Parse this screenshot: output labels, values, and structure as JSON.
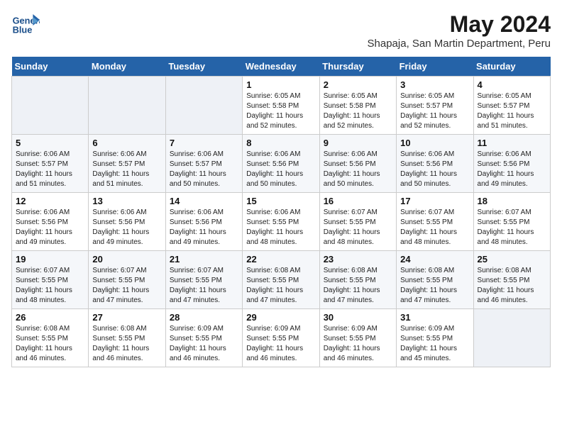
{
  "header": {
    "logo_line1": "General",
    "logo_line2": "Blue",
    "month_year": "May 2024",
    "location": "Shapaja, San Martin Department, Peru"
  },
  "days_of_week": [
    "Sunday",
    "Monday",
    "Tuesday",
    "Wednesday",
    "Thursday",
    "Friday",
    "Saturday"
  ],
  "weeks": [
    [
      {
        "day": "",
        "info": ""
      },
      {
        "day": "",
        "info": ""
      },
      {
        "day": "",
        "info": ""
      },
      {
        "day": "1",
        "info": "Sunrise: 6:05 AM\nSunset: 5:58 PM\nDaylight: 11 hours and 52 minutes."
      },
      {
        "day": "2",
        "info": "Sunrise: 6:05 AM\nSunset: 5:58 PM\nDaylight: 11 hours and 52 minutes."
      },
      {
        "day": "3",
        "info": "Sunrise: 6:05 AM\nSunset: 5:57 PM\nDaylight: 11 hours and 52 minutes."
      },
      {
        "day": "4",
        "info": "Sunrise: 6:05 AM\nSunset: 5:57 PM\nDaylight: 11 hours and 51 minutes."
      }
    ],
    [
      {
        "day": "5",
        "info": "Sunrise: 6:06 AM\nSunset: 5:57 PM\nDaylight: 11 hours and 51 minutes."
      },
      {
        "day": "6",
        "info": "Sunrise: 6:06 AM\nSunset: 5:57 PM\nDaylight: 11 hours and 51 minutes."
      },
      {
        "day": "7",
        "info": "Sunrise: 6:06 AM\nSunset: 5:57 PM\nDaylight: 11 hours and 50 minutes."
      },
      {
        "day": "8",
        "info": "Sunrise: 6:06 AM\nSunset: 5:56 PM\nDaylight: 11 hours and 50 minutes."
      },
      {
        "day": "9",
        "info": "Sunrise: 6:06 AM\nSunset: 5:56 PM\nDaylight: 11 hours and 50 minutes."
      },
      {
        "day": "10",
        "info": "Sunrise: 6:06 AM\nSunset: 5:56 PM\nDaylight: 11 hours and 50 minutes."
      },
      {
        "day": "11",
        "info": "Sunrise: 6:06 AM\nSunset: 5:56 PM\nDaylight: 11 hours and 49 minutes."
      }
    ],
    [
      {
        "day": "12",
        "info": "Sunrise: 6:06 AM\nSunset: 5:56 PM\nDaylight: 11 hours and 49 minutes."
      },
      {
        "day": "13",
        "info": "Sunrise: 6:06 AM\nSunset: 5:56 PM\nDaylight: 11 hours and 49 minutes."
      },
      {
        "day": "14",
        "info": "Sunrise: 6:06 AM\nSunset: 5:56 PM\nDaylight: 11 hours and 49 minutes."
      },
      {
        "day": "15",
        "info": "Sunrise: 6:06 AM\nSunset: 5:55 PM\nDaylight: 11 hours and 48 minutes."
      },
      {
        "day": "16",
        "info": "Sunrise: 6:07 AM\nSunset: 5:55 PM\nDaylight: 11 hours and 48 minutes."
      },
      {
        "day": "17",
        "info": "Sunrise: 6:07 AM\nSunset: 5:55 PM\nDaylight: 11 hours and 48 minutes."
      },
      {
        "day": "18",
        "info": "Sunrise: 6:07 AM\nSunset: 5:55 PM\nDaylight: 11 hours and 48 minutes."
      }
    ],
    [
      {
        "day": "19",
        "info": "Sunrise: 6:07 AM\nSunset: 5:55 PM\nDaylight: 11 hours and 48 minutes."
      },
      {
        "day": "20",
        "info": "Sunrise: 6:07 AM\nSunset: 5:55 PM\nDaylight: 11 hours and 47 minutes."
      },
      {
        "day": "21",
        "info": "Sunrise: 6:07 AM\nSunset: 5:55 PM\nDaylight: 11 hours and 47 minutes."
      },
      {
        "day": "22",
        "info": "Sunrise: 6:08 AM\nSunset: 5:55 PM\nDaylight: 11 hours and 47 minutes."
      },
      {
        "day": "23",
        "info": "Sunrise: 6:08 AM\nSunset: 5:55 PM\nDaylight: 11 hours and 47 minutes."
      },
      {
        "day": "24",
        "info": "Sunrise: 6:08 AM\nSunset: 5:55 PM\nDaylight: 11 hours and 47 minutes."
      },
      {
        "day": "25",
        "info": "Sunrise: 6:08 AM\nSunset: 5:55 PM\nDaylight: 11 hours and 46 minutes."
      }
    ],
    [
      {
        "day": "26",
        "info": "Sunrise: 6:08 AM\nSunset: 5:55 PM\nDaylight: 11 hours and 46 minutes."
      },
      {
        "day": "27",
        "info": "Sunrise: 6:08 AM\nSunset: 5:55 PM\nDaylight: 11 hours and 46 minutes."
      },
      {
        "day": "28",
        "info": "Sunrise: 6:09 AM\nSunset: 5:55 PM\nDaylight: 11 hours and 46 minutes."
      },
      {
        "day": "29",
        "info": "Sunrise: 6:09 AM\nSunset: 5:55 PM\nDaylight: 11 hours and 46 minutes."
      },
      {
        "day": "30",
        "info": "Sunrise: 6:09 AM\nSunset: 5:55 PM\nDaylight: 11 hours and 46 minutes."
      },
      {
        "day": "31",
        "info": "Sunrise: 6:09 AM\nSunset: 5:55 PM\nDaylight: 11 hours and 45 minutes."
      },
      {
        "day": "",
        "info": ""
      }
    ]
  ]
}
